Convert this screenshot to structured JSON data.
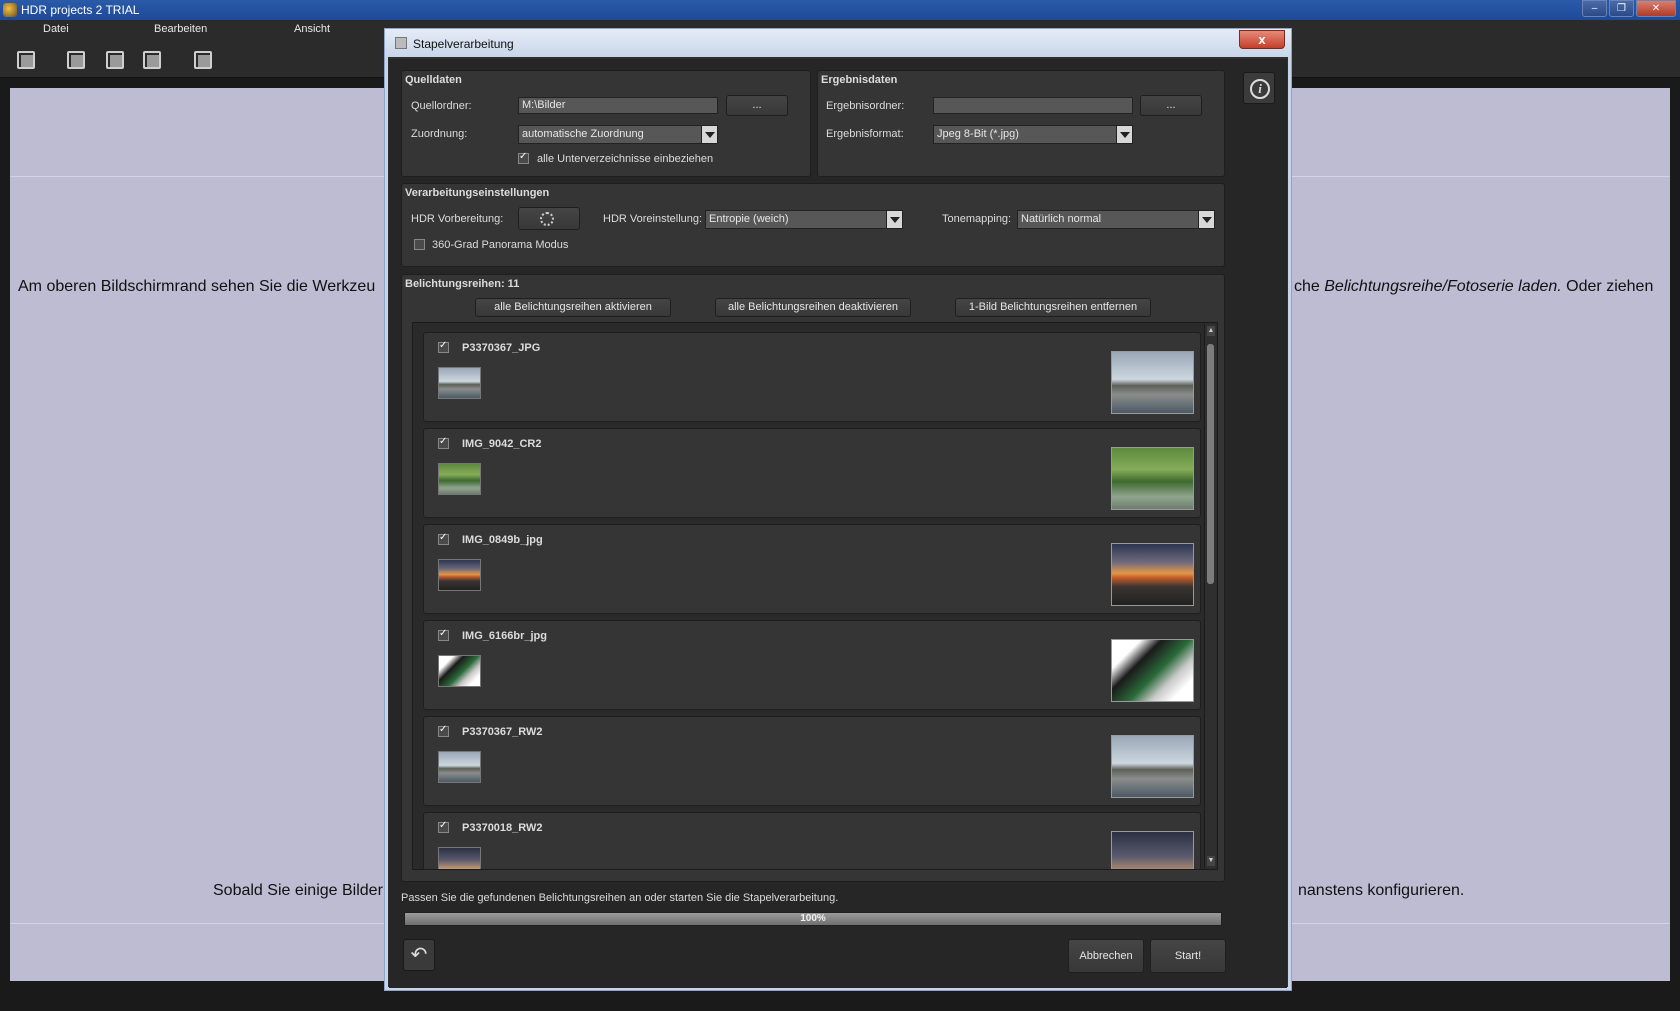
{
  "app": {
    "title": "HDR projects 2  TRIAL",
    "window_buttons": [
      "–",
      "❐",
      "✕"
    ]
  },
  "menu": [
    "Datei",
    "Bearbeiten",
    "Ansicht"
  ],
  "toolbar_icons": [
    "open-icon",
    "export-icon",
    "compare-icon",
    "film-icon",
    "batch-icon"
  ],
  "workspace": {
    "line1_left": "Am oberen Bildschirmrand sehen Sie die Werkzeu",
    "line1_right_prefix": "che ",
    "line1_right_italic": "Belichtungsreihe/Fotoserie laden.",
    "line1_right_suffix": " Oder ziehen",
    "line2_left": "Sobald Sie einige Bilder",
    "line2_right": "nanstens konfigurieren."
  },
  "dialog": {
    "title": "Stapelverarbeitung",
    "close": "x",
    "source": {
      "title": "Quelldaten",
      "folder_label": "Quellordner:",
      "folder_value": "M:\\Bilder",
      "browse": "...",
      "assign_label": "Zuordnung:",
      "assign_value": "automatische Zuordnung",
      "subdirs_label": "alle Unterverzeichnisse einbeziehen",
      "subdirs_checked": true
    },
    "result": {
      "title": "Ergebnisdaten",
      "folder_label": "Ergebnisordner:",
      "folder_value": "",
      "browse": "...",
      "format_label": "Ergebnisformat:",
      "format_value": "Jpeg 8-Bit (*.jpg)"
    },
    "processing": {
      "title": "Verarbeitungseinstellungen",
      "hdr_prep_label": "HDR Vorbereitung:",
      "hdr_preset_label": "HDR Voreinstellung:",
      "hdr_preset_value": "Entropie (weich)",
      "tonemapping_label": "Tonemapping:",
      "tonemapping_value": "Natürlich normal",
      "panorama_label": "360-Grad Panorama Modus",
      "panorama_checked": false
    },
    "series": {
      "title": "Belichtungsreihen: 11",
      "btn_activate": "alle Belichtungsreihen aktivieren",
      "btn_deactivate": "alle Belichtungsreihen deaktivieren",
      "btn_remove": "1-Bild Belichtungsreihen entfernen",
      "items": [
        {
          "name": "P3370367_JPG",
          "checked": true
        },
        {
          "name": "IMG_9042_CR2",
          "checked": true
        },
        {
          "name": "IMG_0849b_jpg",
          "checked": true
        },
        {
          "name": "IMG_6166br_jpg",
          "checked": true
        },
        {
          "name": "P3370367_RW2",
          "checked": true
        },
        {
          "name": "P3370018_RW2",
          "checked": true
        }
      ]
    },
    "footer": {
      "status": "Passen Sie die gefundenen Belichtungsreihen an oder starten Sie die Stapelverarbeitung.",
      "progress_label": "100%",
      "progress_fraction": 1.0,
      "cancel": "Abbrechen",
      "start": "Start!"
    }
  }
}
